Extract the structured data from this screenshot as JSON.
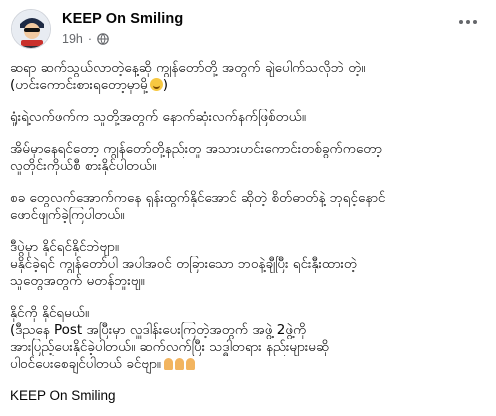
{
  "post": {
    "author": "KEEP On Smiling",
    "time": "19h",
    "separator": "·",
    "privacy_icon": "globe-icon",
    "more_icon": "more-dots-icon",
    "avatar_icon": "avatar-icon",
    "lines": [
      "ဆရာ ဆက်သွယ်လာတဲ့နေ့ဆို ကျွန်တော်တို့ အတွက် ချဲပေါက်သလိုဘဲ တဲ့။",
      "(ဟင်းကောင်းစားရတော့မှာမို့",
      "ရှုံးရဲ့လက်ဖက်က သူတို့အတွက် နောက်ဆုံးလက်နက်ဖြစ်တယ်။",
      "အိမ်မှာနေရင်တော့ ကျွန်တော်တို့နည်းတူ အသားဟင်းကောင်းတစ်ခွက်ကတော့",
      "လူတိုင်းကိုယ်စီ စားနိုင်ပါတယ်။",
      "စခ တွေလက်အောက်ကနေ ရှန်းထွက်နိုင်အောင် ဆိုတဲ့ စိတ်ဓာတ်နဲ့ ဘုရင့်နောင်",
      "ဖောင်ဖျက်ခဲ့ကြပါတယ်။",
      "ဒီပွဲမှာ နိုင်ရင်နိုင်ဘဲဗျာ။",
      " မနိုင်ခဲ့ရင် ကျွန်တော်ပါ အပါအဝင် တခြားသော ဘဝနဲ့ချီပြီး ရင်းနှီးထားတဲ့",
      "သူတွေအတွက် မတန်ဘူးဗျ။",
      "နိုင်ကို နိုင်ရမယ်။",
      "(ဒီညနေ Post အပြီးမှာ လှူဒါန်းပေးကြတဲ့အတွက် အဖွဲ့ 2ဖွဲ့ကို",
      "အားပြည့်ပေးနိုင်ခဲ့ပါတယ်။ ဆက်လက်ပြီး သဒ္ဓါတရား နည်းများမဆို",
      "ပါဝင်ပေးစေချင်ပါတယ် ခင်ဗျာ။"
    ],
    "signature": "KEEP On Smiling"
  },
  "colors": {
    "text": "#050505",
    "meta": "#65676b"
  }
}
